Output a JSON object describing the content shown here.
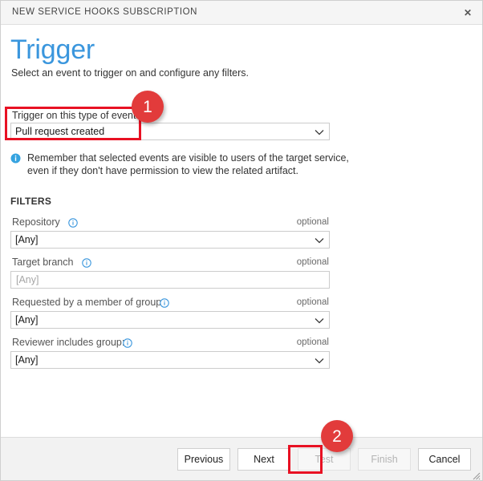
{
  "window": {
    "title": "NEW SERVICE HOOKS SUBSCRIPTION",
    "close_icon": "close-icon",
    "close_glyph": "✕"
  },
  "page": {
    "title": "Trigger",
    "subtitle": "Select an event to trigger on and configure any filters.",
    "title_color": "#3a96dd"
  },
  "trigger": {
    "label": "Trigger on this type of event",
    "selected_value": "Pull request created",
    "chevron_icon": "chevron-down-icon"
  },
  "info_note": {
    "icon": "info-icon",
    "text": "Remember that selected events are visible to users of the target service, even if they don't have permission to view the related artifact."
  },
  "filters": {
    "heading": "FILTERS",
    "optional_label": "optional",
    "info_icon": "info-icon",
    "fields": [
      {
        "label": "Repository",
        "has_info_icon": true,
        "control": "dropdown",
        "value": "[Any]",
        "optional": "optional"
      },
      {
        "label": "Target branch",
        "has_info_icon": true,
        "control": "textbox",
        "value": "[Any]",
        "optional": "optional"
      },
      {
        "label": "Requested by a member of group:",
        "has_info_icon": true,
        "control": "dropdown",
        "value": "[Any]",
        "optional": "optional"
      },
      {
        "label": "Reviewer includes group:",
        "has_info_icon": true,
        "control": "dropdown",
        "value": "[Any]",
        "optional": "optional"
      }
    ]
  },
  "footer": {
    "buttons": [
      {
        "label": "Previous",
        "disabled": false
      },
      {
        "label": "Next",
        "disabled": false
      },
      {
        "label": "Test",
        "disabled": true
      },
      {
        "label": "Finish",
        "disabled": true
      },
      {
        "label": "Cancel",
        "disabled": false
      }
    ],
    "resize_grip_icon": "resize-grip-icon"
  },
  "annotations": {
    "color": "#e81123",
    "badge_color": "#e23b3b",
    "badge_1": "1",
    "badge_2": "2"
  }
}
